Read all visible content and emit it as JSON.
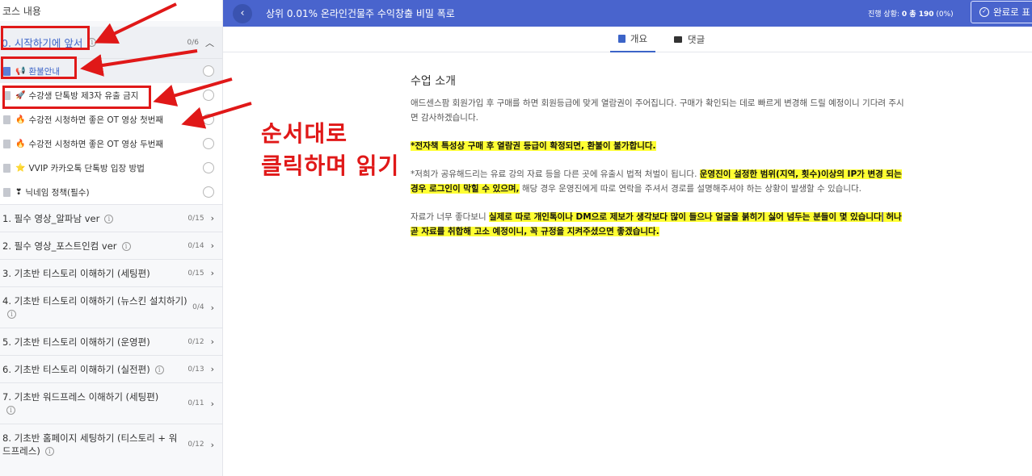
{
  "sidebar": {
    "title": "코스 내용",
    "open_section": {
      "label": "0. 시작하기에 앞서",
      "count": "0/6"
    },
    "lessons": [
      {
        "icon": "📢",
        "label": "환불안내",
        "active": true
      },
      {
        "icon": "🚀",
        "label": "수강생 단톡방 제3자 유출 금지"
      },
      {
        "icon": "🔥",
        "label": "수강전 시청하면 좋은 OT 영상 첫번째"
      },
      {
        "icon": "🔥",
        "label": "수강전 시청하면 좋은 OT 영상 두번째"
      },
      {
        "icon": "⭐",
        "label": "VVIP 카카오톡 단톡방 입장 방법"
      },
      {
        "icon": "❣",
        "label": "닉네임 정책(필수)"
      }
    ],
    "sections": [
      {
        "title": "1. 필수 영상_알파남 ver",
        "count": "0/15"
      },
      {
        "title": "2. 필수 영상_포스트인컴 ver",
        "count": "0/14"
      },
      {
        "title": "3. 기초반 티스토리 이해하기 (세팅편)",
        "count": "0/15"
      },
      {
        "title": "4. 기초반 티스토리 이해하기 (뉴스킨 설치하기)",
        "count": "0/4"
      },
      {
        "title": "5. 기초반 티스토리 이해하기 (운영편)",
        "count": "0/12"
      },
      {
        "title": "6. 기초반 티스토리 이해하기 (실전편)",
        "count": "0/13"
      },
      {
        "title": "7. 기초반 워드프레스 이해하기 (세팅편)",
        "count": "0/11"
      },
      {
        "title": "8. 기초반 홈페이지 세팅하기 (티스토리 + 워드프레스)",
        "count": "0/12"
      }
    ]
  },
  "header": {
    "title": "상위 0.01% 온라인건물주 수익창출 비밀 폭로",
    "progress_label": "진행 상황:",
    "progress_value": "0 총 190",
    "progress_pct": "(0%)",
    "complete_label": "완료로 표"
  },
  "tabs": {
    "overview": "개요",
    "comments": "댓글"
  },
  "content": {
    "heading": "수업 소개",
    "p1": "애드센스팜 회원가입 후 구매를 하면 회원등급에 맞게 열람권이 주어집니다. 구매가 확인되는 데로 빠르게 변경해 드릴 예정이니 기다려 주시면 감사하겠습니다.",
    "p2_hl": "*전자책 특성상 구매 후 열람권 등급이 확정되면, 환불이 불가합니다.",
    "p3_a": "*저희가 공유해드리는 유료 강의 자료 등을 다른 곳에 유출시 법적 처벌이 됩니다. ",
    "p3_hl": "운영진이 설정한 범위(지역, 횟수)이상의 IP가 변경 되는 경우 로그인이 막힐 수 있으며,",
    "p3_b": " 해당 경우 운영진에게 따로 연락을 주셔서 경로를 설명해주셔야 하는 상황이 발생할 수 있습니다.",
    "p4_a": "자료가 너무 좋다보니 ",
    "p4_hl1": "실제로 따로 개인톡이나 DM으로 제보가 생각보다 많이 들으나 얼굴을 붉히기 싫어 넘두는 분들이 몇 있습니다",
    "p4_hl2": " 허나 곧 자료를 취합해 고소 예정이니, 꼭 규정을 지켜주셨으면 좋겠습니다."
  },
  "annotation": {
    "line1": "순서대로",
    "line2": "클릭하며 읽기",
    "color": "#e01818"
  }
}
